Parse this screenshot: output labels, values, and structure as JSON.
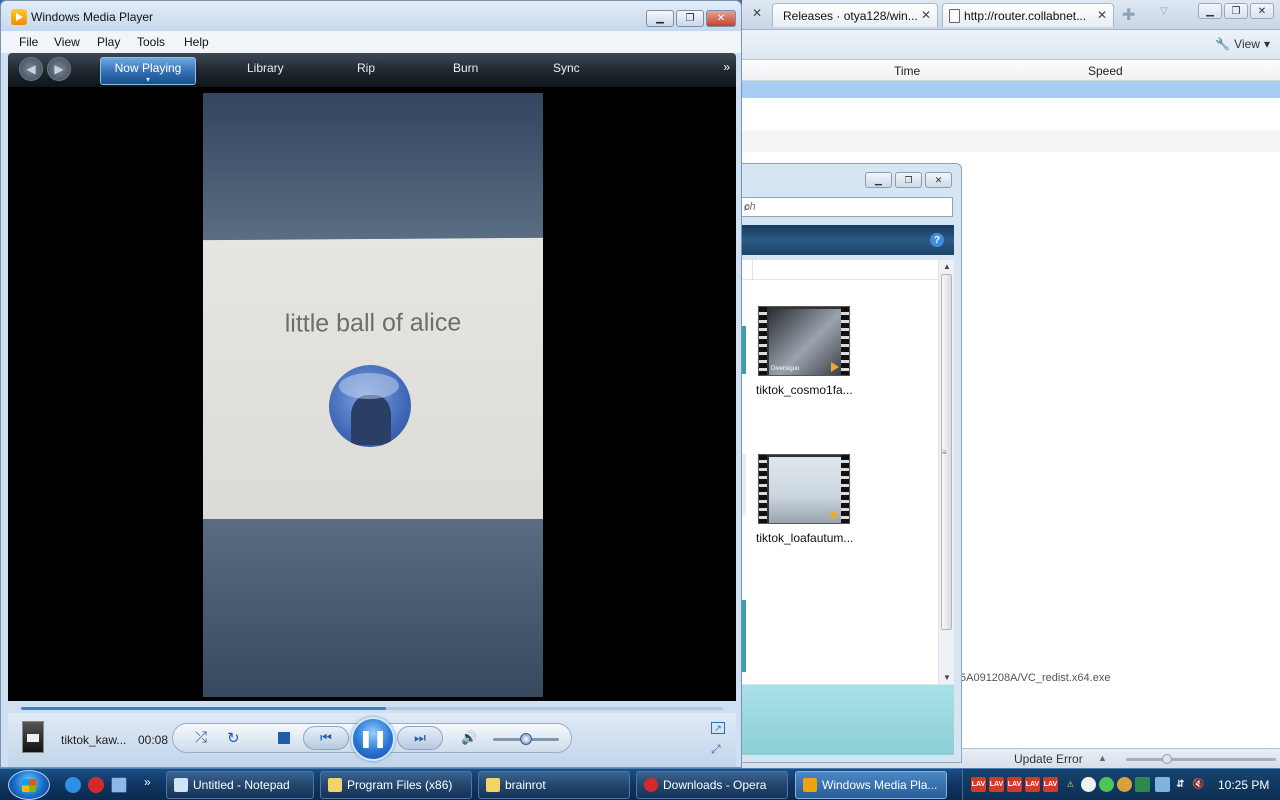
{
  "browser": {
    "tabs": [
      {
        "label": "Releases · otya128/win..."
      },
      {
        "label": "http://router.collabnet..."
      }
    ],
    "view_label": "View",
    "downloads_header": {
      "time": "Time",
      "speed": "Speed"
    },
    "download_path_fragment": "5A091208A/VC_redist.x64.exe",
    "status": {
      "update_error": "Update Error"
    }
  },
  "explorer": {
    "search_placeholder_fragment": "ch",
    "files": [
      {
        "name": "tiktok_cosmo1fa...",
        "thumb_label": "Diversiguo"
      },
      {
        "name": "tiktok_loafautum..."
      }
    ]
  },
  "wmp": {
    "title": "Windows Media Player",
    "menu": {
      "file": "File",
      "view": "View",
      "play": "Play",
      "tools": "Tools",
      "help": "Help"
    },
    "nav_tabs": [
      {
        "label": "Now Playing",
        "active": true
      },
      {
        "label": "Library"
      },
      {
        "label": "Rip"
      },
      {
        "label": "Burn"
      },
      {
        "label": "Sync"
      }
    ],
    "video_caption": "little ball of alice",
    "now_playing": {
      "track": "tiktok_kaw...",
      "time": "00:08"
    },
    "seek_progress": 0.52,
    "volume": 0.5,
    "state": "playing"
  },
  "taskbar": {
    "items": [
      {
        "label": "Untitled - Notepad",
        "icon_color": "#cfe3f5"
      },
      {
        "label": "Program Files (x86)",
        "icon_color": "#f3d36a"
      },
      {
        "label": "brainrot",
        "icon_color": "#f3d36a"
      },
      {
        "label": "Downloads - Opera",
        "icon_color": "#d32b2b"
      },
      {
        "label": "Windows Media Pla...",
        "icon_color": "#f2a10f",
        "active": true
      }
    ],
    "tray_icons": [
      "LAV",
      "LAV",
      "LAV",
      "LAV",
      "LAV"
    ],
    "clock": "10:25 PM"
  }
}
